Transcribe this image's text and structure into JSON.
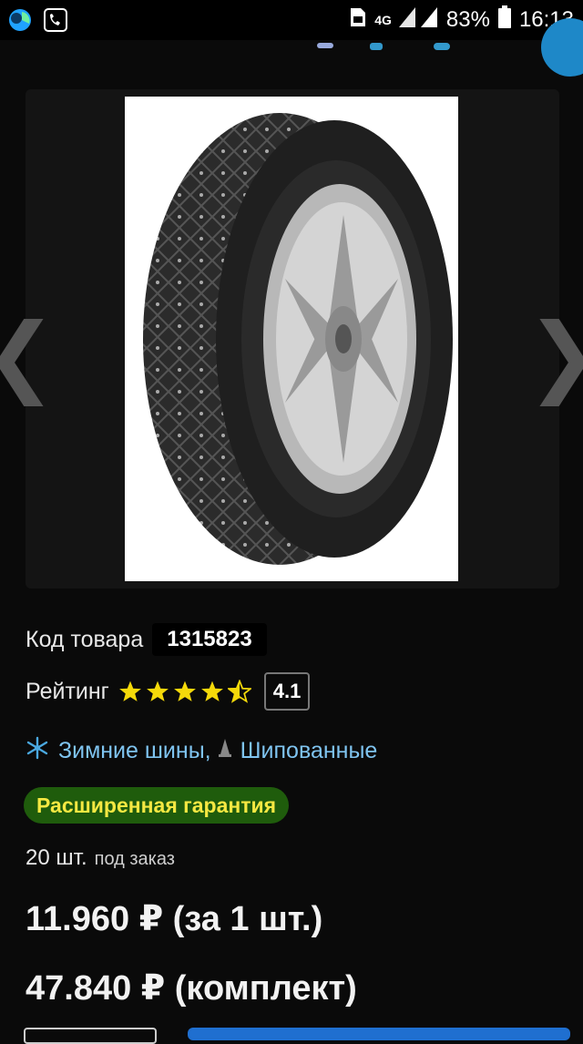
{
  "status": {
    "battery": "83%",
    "time": "16:13",
    "network": "4G"
  },
  "product": {
    "code_label": "Код товара",
    "code": "1315823",
    "rating_label": "Рейтинг",
    "rating_value": "4.1",
    "stars": 4.1,
    "categories": [
      "Зимние шины,",
      "Шипованные"
    ],
    "warranty": "Расширенная гарантия",
    "stock_qty": "20 шт.",
    "stock_note": "под заказ",
    "price_unit": "11.960 ₽ (за 1 шт.)",
    "price_set": "47.840 ₽ (комплект)"
  },
  "gallery": {
    "prev": "❮",
    "next": "❯"
  },
  "colors": {
    "accent": "#1e88c8",
    "link": "#7fc4f0",
    "warranty_bg": "#1f5c0c",
    "warranty_text": "#f5e842",
    "star": "#f5d90a"
  },
  "icons": [
    "phone-icon",
    "snowflake-icon",
    "spike-icon",
    "star-icon"
  ]
}
